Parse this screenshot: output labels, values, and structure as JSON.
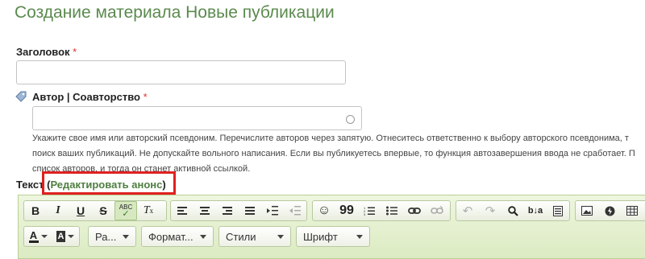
{
  "page": {
    "title": "Создание материала Новые публикации"
  },
  "form": {
    "title_label": "Заголовок",
    "required_mark": "*",
    "author_label": "Автор | Соавторство",
    "help_lines": [
      "Укажите свое имя или авторский псевдоним. Перечислите авторов через запятую. Отнеситесь ответственно к выбору авторского псевдонима, т",
      "поиск ваших публикаций. Не допускайте вольного написания. Если вы публикуетесь впервые, то функция автозавершения ввода не сработает. П",
      "список авторов, и тогда он станет активной ссылкой."
    ],
    "text_label": "Текст",
    "edit_announce": "Редактировать анонс",
    "paren_open": "(",
    "paren_close": ")"
  },
  "toolbar": {
    "row1": {
      "bold": "B",
      "italic": "I",
      "underline": "U",
      "strike": "S",
      "spellcheck": "ABC",
      "remove_format": "T",
      "quote": "99"
    },
    "combos": {
      "paragraph": "Ра...",
      "format": "Формат...",
      "styles": "Стили",
      "font": "Шрифт"
    },
    "text_color": "A",
    "bg_color": "A"
  },
  "colors": {
    "accent": "#5b8a4e",
    "highlight": "#e02020",
    "toolbar_bg": "#dcebc2"
  }
}
